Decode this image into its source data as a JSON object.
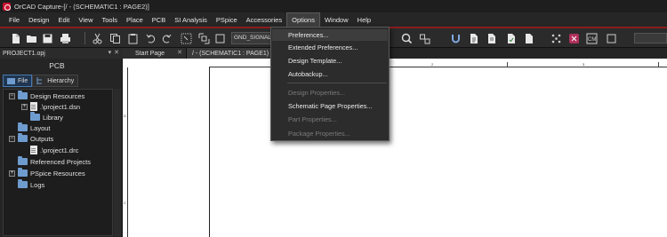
{
  "window": {
    "title": "OrCAD Capture-[/ - (SCHEMATIC1 : PAGE2)]"
  },
  "menubar": {
    "items": [
      "File",
      "Design",
      "Edit",
      "View",
      "Tools",
      "Place",
      "PCB",
      "SI Analysis",
      "PSpice",
      "Accessories",
      "Options",
      "Window",
      "Help"
    ],
    "active": "Options"
  },
  "toolbar": {
    "net_combo_value": "GND_SIGNAL",
    "icons": [
      "new-icon",
      "open-icon",
      "save-icon",
      "print-icon",
      "cut-icon",
      "copy-icon",
      "paste-icon",
      "undo-icon",
      "redo-icon",
      "snap-grid-icon",
      "area-select-icon",
      "zoom-icon",
      "magnet-icon",
      "netlist-icon",
      "bom-icon",
      "drc-icon",
      "cross-probe-icon",
      "cm-icon"
    ]
  },
  "options_menu": {
    "items": [
      {
        "label": "Preferences...",
        "enabled": true,
        "highlighted": true
      },
      {
        "label": "Extended Preferences...",
        "enabled": true
      },
      {
        "label": "Design Template...",
        "enabled": true
      },
      {
        "label": "Autobackup...",
        "enabled": true
      },
      {
        "label": "Design Properties...",
        "enabled": false
      },
      {
        "label": "Schematic Page Properties...",
        "enabled": true
      },
      {
        "label": "Part Properties...",
        "enabled": false
      },
      {
        "label": "Package Properties...",
        "enabled": false
      }
    ]
  },
  "project_panel": {
    "header": "PROJECT1.opj",
    "title": "PCB",
    "tabs": [
      {
        "label": "File",
        "selected": true
      },
      {
        "label": "Hierarchy",
        "selected": false
      }
    ],
    "tree": [
      {
        "label": "Design Resources",
        "level": 0,
        "expander": "-",
        "type": "folder"
      },
      {
        "label": ".\\project1.dsn",
        "level": 1,
        "expander": "+",
        "type": "file"
      },
      {
        "label": "Library",
        "level": 1,
        "expander": "",
        "type": "folder"
      },
      {
        "label": "Layout",
        "level": 0,
        "expander": "",
        "type": "folder"
      },
      {
        "label": "Outputs",
        "level": 0,
        "expander": "-",
        "type": "folder"
      },
      {
        "label": ".\\project1.drc",
        "level": 1,
        "expander": "",
        "type": "file"
      },
      {
        "label": "Referenced Projects",
        "level": 0,
        "expander": "",
        "type": "folder"
      },
      {
        "label": "PSpice Resources",
        "level": 0,
        "expander": "+",
        "type": "folder"
      },
      {
        "label": "Logs",
        "level": 0,
        "expander": "",
        "type": "folder"
      }
    ]
  },
  "doc_tabs": [
    {
      "label": "Start Page",
      "selected": false
    },
    {
      "label": "/ - (SCHEMATIC1 : PAGE1)",
      "selected": false
    }
  ],
  "canvas": {
    "ruler_top_labels": [
      "1",
      "2",
      "3",
      "4"
    ],
    "ruler_left_labels": [
      "D",
      "C"
    ]
  },
  "colors": {
    "accent_red": "#8c1c1c",
    "folder_blue": "#6f9ccf",
    "menu_bg": "#2c2c2c"
  }
}
